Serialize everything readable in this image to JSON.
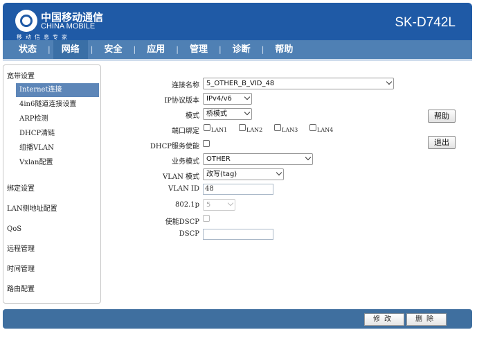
{
  "header": {
    "logo_cn": "中国移动通信",
    "logo_en": "CHINA MOBILE",
    "logo_sub": "移动信息专家",
    "model": "SK-D742L"
  },
  "nav": {
    "items": [
      "状态",
      "网络",
      "安全",
      "应用",
      "管理",
      "诊断",
      "帮助"
    ],
    "active": "网络"
  },
  "sidebar": {
    "group_title": "宽带设置",
    "sub_items": [
      "Internet连接",
      "4in6隧道连接设置",
      "ARP检测",
      "DHCP清链",
      "组播VLAN",
      "Vxlan配置"
    ],
    "active_sub": "Internet连接",
    "items": [
      "绑定设置",
      "LAN侧地址配置",
      "QoS",
      "远程管理",
      "时间管理",
      "路由配置"
    ]
  },
  "form": {
    "connection_name": {
      "label": "连接名称",
      "value": "5_OTHER_B_VID_48"
    },
    "ip_version": {
      "label": "IP协议版本",
      "value": "IPv4/v6"
    },
    "mode": {
      "label": "模式",
      "value": "桥模式"
    },
    "port_binding": {
      "label": "端口绑定",
      "ports": [
        "LAN1",
        "LAN2",
        "LAN3",
        "LAN4"
      ]
    },
    "dhcp_enable": {
      "label": "DHCP服务使能"
    },
    "service_mode": {
      "label": "业务模式",
      "value": "OTHER"
    },
    "vlan_mode": {
      "label": "VLAN 模式",
      "value": "改写(tag)"
    },
    "vlan_id": {
      "label": "VLAN ID",
      "value": "48"
    },
    "dot1p": {
      "label": "802.1p",
      "value": "5"
    },
    "dscp_enable": {
      "label": "使能DSCP"
    },
    "dscp": {
      "label": "DSCP",
      "value": ""
    }
  },
  "buttons": {
    "help": "帮助",
    "logout": "退出"
  },
  "footer": {
    "modify": "修改",
    "delete": "删除"
  }
}
